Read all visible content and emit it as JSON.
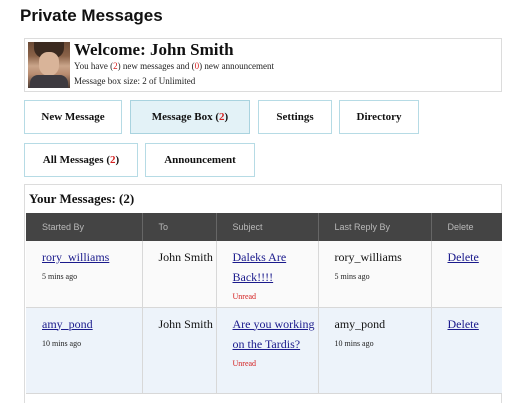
{
  "page_title": "Private Messages",
  "welcome": {
    "title": "Welcome: John Smith",
    "line1_prefix": "You have (",
    "new_messages": "2",
    "line1_mid": ") new messages and (",
    "new_announcements": "0",
    "line1_suffix": ") new announcement",
    "box_size": "Message box size: 2 of Unlimited"
  },
  "nav": {
    "new_message": "New Message",
    "message_box": "Message Box (",
    "message_box_count": "2",
    "message_box_close": ")",
    "settings": "Settings",
    "directory": "Directory",
    "all_messages": "All Messages (",
    "all_messages_count": "2",
    "all_messages_close": ")",
    "announcement": "Announcement"
  },
  "messages": {
    "title": "Your Messages: (2)",
    "columns": [
      "Started By",
      "To",
      "Subject",
      "Last Reply By",
      "Delete"
    ],
    "rows": [
      {
        "started_by": "rory_williams",
        "time": "5 mins ago",
        "to": "John Smith",
        "subject": "Daleks Are Back!!!!",
        "status": "Unread",
        "last_reply_by": "rory_williams",
        "last_reply_time": "5 mins ago",
        "delete": "Delete"
      },
      {
        "started_by": "amy_pond",
        "time": "10 mins ago",
        "to": "John Smith",
        "subject": "Are you working on the Tardis?",
        "status": "Unread",
        "last_reply_by": "amy_pond",
        "last_reply_time": "10 mins ago",
        "delete": "Delete"
      }
    ]
  },
  "colors": {
    "accent_red": "#d42020",
    "header_bg": "#444444",
    "button_border": "#b6dbe5",
    "active_button_bg": "#e3f2f7",
    "link": "#1a1a8c"
  }
}
